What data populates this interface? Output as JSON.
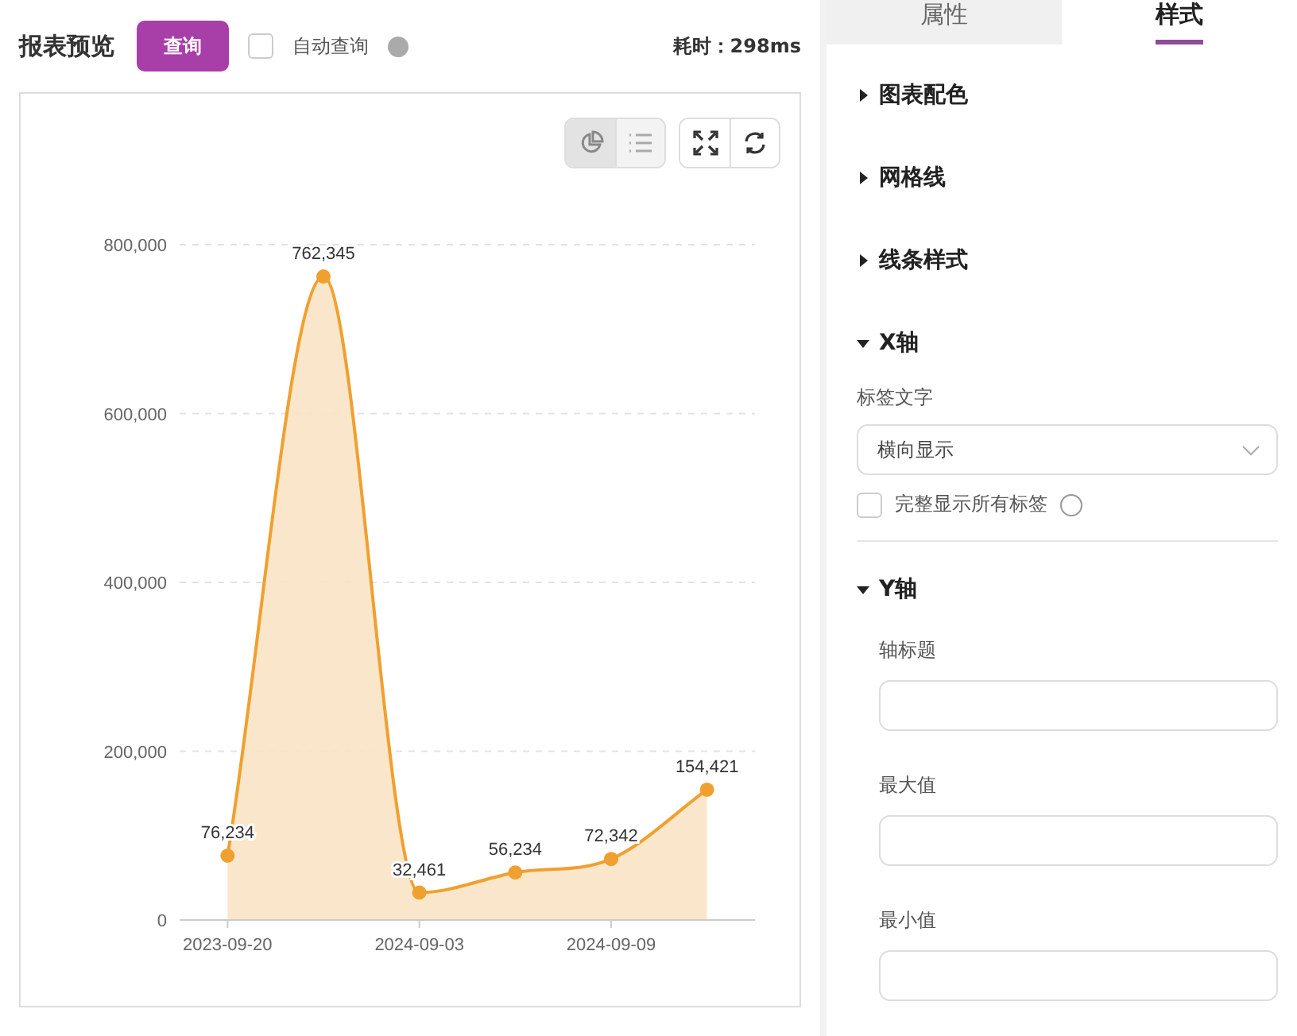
{
  "header": {
    "title": "报表预览",
    "query_button": "查询",
    "auto_query": {
      "label": "自动查询",
      "checked": false
    },
    "elapsed": "耗时：298ms"
  },
  "chart_toolbar": {
    "view_toggle": [
      {
        "kind": "chart",
        "selected": true
      },
      {
        "kind": "list",
        "selected": false
      }
    ]
  },
  "chart": {
    "chart_data": {
      "type": "area",
      "categories": [
        "2023-09-20",
        null,
        "2024-09-03",
        null,
        "2024-09-09",
        null
      ],
      "series": [
        {
          "color": "#f0a030",
          "values": [
            76234,
            762345,
            32461,
            56234,
            72342,
            154421
          ]
        }
      ],
      "ylim": [
        0,
        800000
      ],
      "grid": true,
      "yticks": [
        {
          "value": 0,
          "label": "0"
        },
        {
          "value": 200000,
          "label": "200,000"
        },
        {
          "value": 400000,
          "label": "400,000"
        },
        {
          "value": 600000,
          "label": "600,000"
        },
        {
          "value": 800000,
          "label": "800,000"
        }
      ],
      "value_labels": [
        "76,234",
        "762,345",
        "32,461",
        "56,234",
        "72,342",
        "154,421"
      ]
    }
  },
  "panel": {
    "tabs": [
      {
        "label": "属性",
        "selected": false
      },
      {
        "label": "样式",
        "selected": true
      }
    ],
    "sections": [
      {
        "title": "图表配色",
        "expanded": false
      },
      {
        "title": "网格线",
        "expanded": false
      },
      {
        "title": "线条样式",
        "expanded": false
      },
      {
        "title": "X轴",
        "expanded": true,
        "fields": [
          {
            "kind": "select",
            "label": "标签文字",
            "value": "横向显示"
          },
          {
            "kind": "checkbox",
            "label": "完整显示所有标签",
            "checked": false
          }
        ]
      },
      {
        "title": "Y轴",
        "expanded": true,
        "fields": [
          {
            "kind": "input",
            "label": "轴标题"
          },
          {
            "kind": "input",
            "label": "最大值"
          },
          {
            "kind": "input",
            "label": "最小值"
          }
        ]
      }
    ]
  }
}
